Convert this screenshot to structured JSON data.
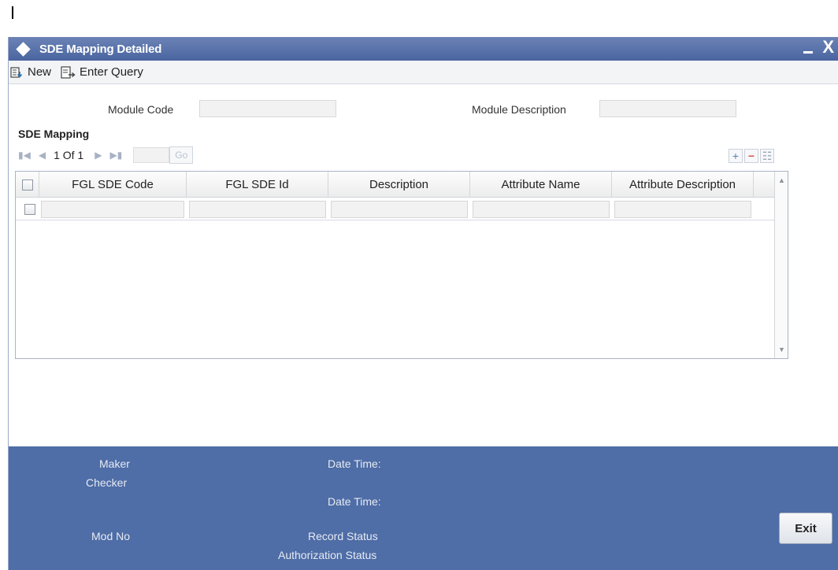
{
  "window": {
    "title": "SDE Mapping Detailed",
    "close_glyph": "X"
  },
  "toolbar": {
    "new_label": "New",
    "enter_query_label": "Enter Query"
  },
  "form": {
    "module_code_label": "Module Code",
    "module_code_value": "",
    "module_description_label": "Module Description",
    "module_description_value": ""
  },
  "grid": {
    "section_title": "SDE Mapping",
    "pager_text": "1 Of 1",
    "go_label": "Go",
    "columns": [
      "FGL SDE Code",
      "FGL SDE Id",
      "Description",
      "Attribute Name",
      "Attribute Description"
    ],
    "rows": [
      {
        "fgl_sde_code": "",
        "fgl_sde_id": "",
        "description": "",
        "attribute_name": "",
        "attribute_description": ""
      }
    ],
    "add_row_glyph": "+",
    "delete_row_glyph": "−",
    "view_row_glyph": "☷"
  },
  "footer": {
    "maker_label": "Maker",
    "checker_label": "Checker",
    "date_time_label_1": "Date Time:",
    "date_time_label_2": "Date Time:",
    "mod_no_label": "Mod No",
    "record_status_label": "Record Status",
    "authorization_status_label": "Authorization Status",
    "exit_label": "Exit"
  },
  "colors": {
    "titlebar": "#4a64a0",
    "footer": "#4f6da6",
    "add_icon": "#5a7ab8",
    "delete_icon": "#d9534f"
  }
}
